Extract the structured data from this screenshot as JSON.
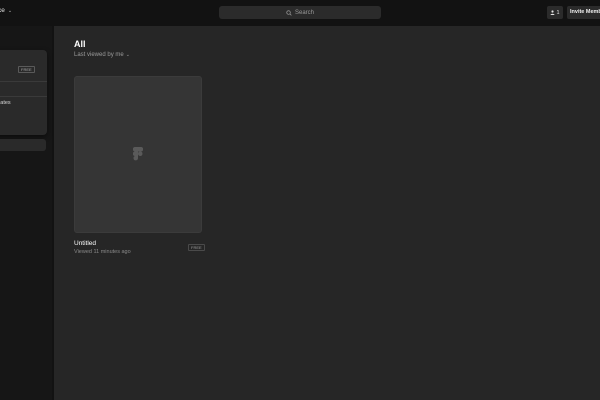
{
  "topbar": {
    "workspace_title": "ce",
    "workspace_chevron_icon": "chevron-down-icon",
    "search": {
      "placeholder": "Search",
      "icon": "search-icon"
    },
    "member_count": "1",
    "member_icon": "person-icon",
    "invite_label": "Invite Members"
  },
  "sidebar": {
    "panel": {
      "plan_tag": "FREE",
      "row_1": "y",
      "row_2": "plates"
    }
  },
  "main": {
    "title": "All",
    "sort_label": "Last viewed by me",
    "files": [
      {
        "name": "Untitled",
        "meta": "Viewed 11 minutes ago",
        "tag": "FREE",
        "thumbnail_icon": "figma-logo-icon"
      }
    ]
  },
  "colors": {
    "topbar_bg": "#121212",
    "sidebar_bg": "#161616",
    "main_bg": "#262626",
    "card_bg": "#353535",
    "panel_bg": "#2a2a2a"
  }
}
